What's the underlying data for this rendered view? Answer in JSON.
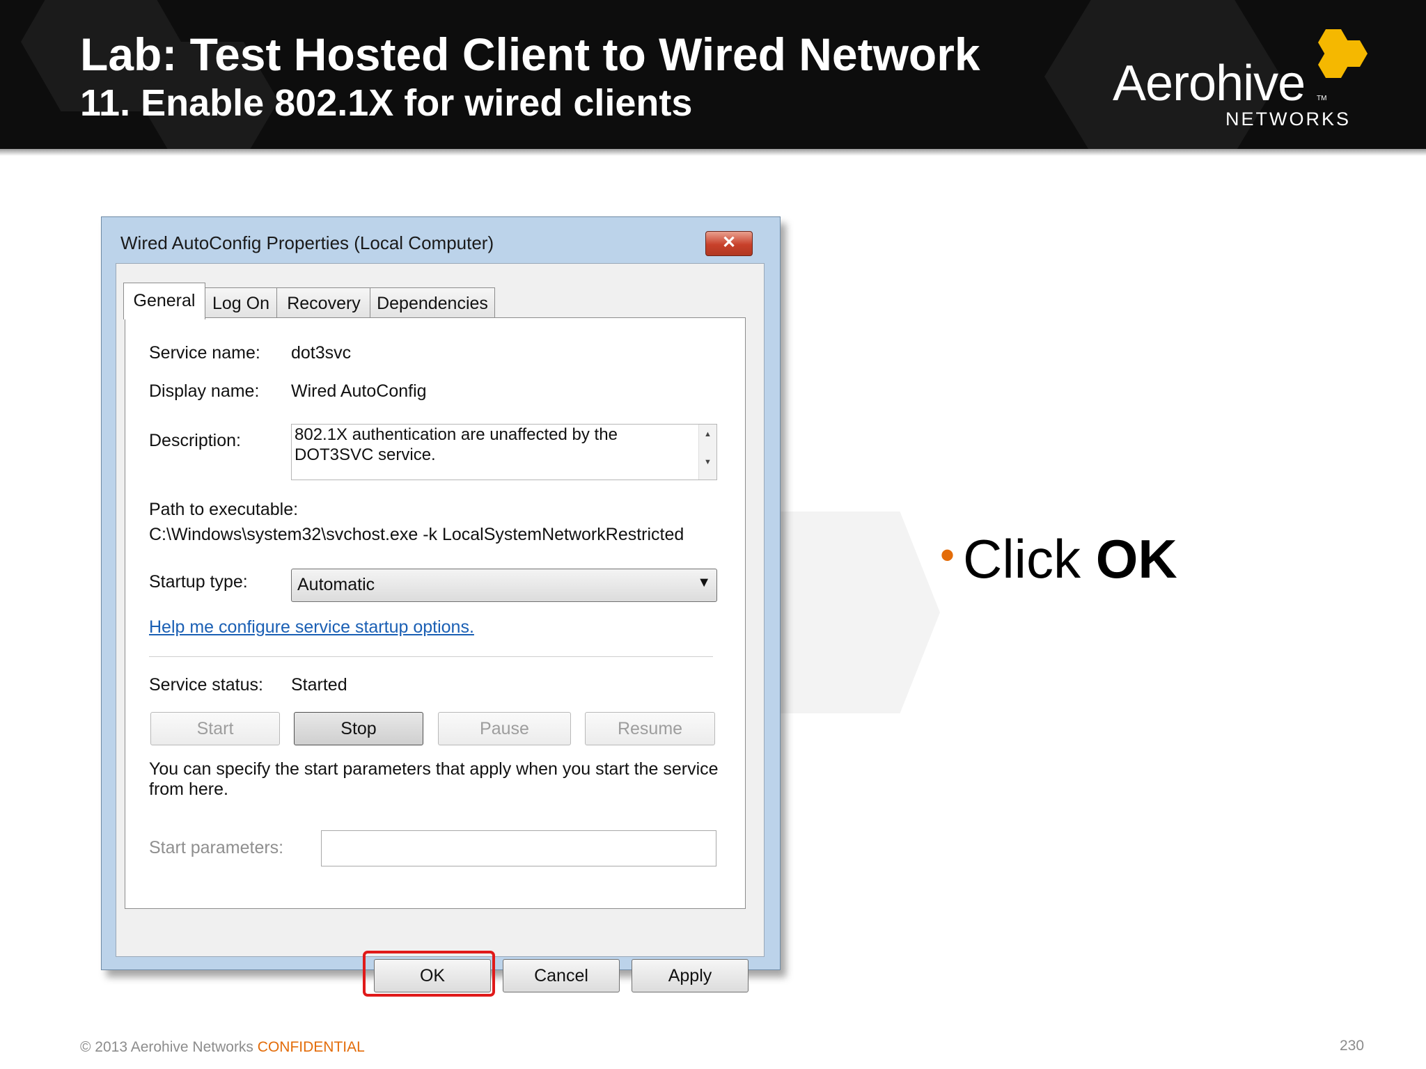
{
  "slide": {
    "title": "Lab: Test Hosted Client to Wired Network",
    "subtitle": "11. Enable 802.1X for wired clients",
    "logo_word": "Aerohive",
    "logo_tm": "TM",
    "logo_sub": "NETWORKS",
    "bullet_prefix": "Click ",
    "bullet_bold": "OK",
    "footer_copyright": "© 2013 Aerohive Networks ",
    "footer_confidential": "CONFIDENTIAL",
    "page_number": "230",
    "accent_color": "#e36c09",
    "logo_color": "#f5b800"
  },
  "dialog": {
    "title": "Wired AutoConfig Properties (Local Computer)",
    "close_glyph": "✕",
    "tabs": [
      {
        "label": "General",
        "active": true
      },
      {
        "label": "Log On",
        "active": false
      },
      {
        "label": "Recovery",
        "active": false
      },
      {
        "label": "Dependencies",
        "active": false
      }
    ],
    "service_name_label": "Service name:",
    "service_name_value": "dot3svc",
    "display_name_label": "Display name:",
    "display_name_value": "Wired AutoConfig",
    "description_label": "Description:",
    "description_value": "802.1X authentication are unaffected by the DOT3SVC service.",
    "path_label": "Path to executable:",
    "path_value": "C:\\Windows\\system32\\svchost.exe -k LocalSystemNetworkRestricted",
    "startup_type_label": "Startup type:",
    "startup_type_value": "Automatic",
    "help_link": "Help me configure service startup options.",
    "service_status_label": "Service status:",
    "service_status_value": "Started",
    "buttons": {
      "start": "Start",
      "stop": "Stop",
      "pause": "Pause",
      "resume": "Resume",
      "ok": "OK",
      "cancel": "Cancel",
      "apply": "Apply"
    },
    "params_note": "You can specify the start parameters that apply when you start the service from here.",
    "start_params_label": "Start parameters:",
    "start_params_value": ""
  }
}
